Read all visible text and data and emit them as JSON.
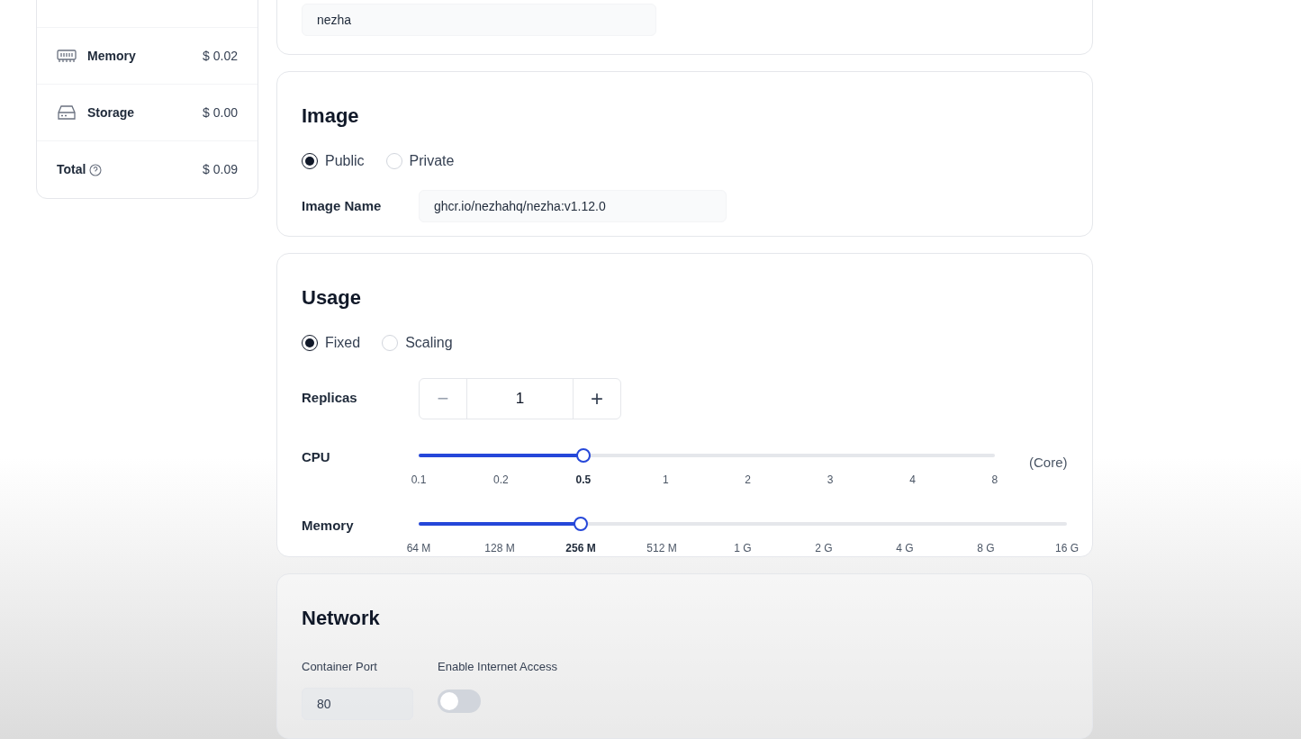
{
  "top_card": {
    "name_value": "nezha"
  },
  "cost": {
    "items": [
      {
        "kind": "memory",
        "label": "Memory",
        "value": "$ 0.02"
      },
      {
        "kind": "storage",
        "label": "Storage",
        "value": "$ 0.00"
      }
    ],
    "total_label": "Total",
    "total_value": "$ 0.09"
  },
  "image": {
    "title": "Image",
    "types": [
      {
        "label": "Public",
        "selected": true
      },
      {
        "label": "Private",
        "selected": false
      }
    ],
    "name_label": "Image Name",
    "name_value": "ghcr.io/nezhahq/nezha:v1.12.0"
  },
  "usage": {
    "title": "Usage",
    "modes": [
      {
        "label": "Fixed",
        "selected": true
      },
      {
        "label": "Scaling",
        "selected": false
      }
    ],
    "replicas": {
      "label": "Replicas",
      "minus": "−",
      "value": "1",
      "plus": "+"
    },
    "sliders": [
      {
        "label": "CPU",
        "level": 0.2857,
        "unit": "(Core)",
        "ticks": [
          {
            "label": "0.1",
            "selected": false
          },
          {
            "label": "0.2",
            "selected": false
          },
          {
            "label": "0.5",
            "selected": true
          },
          {
            "label": "1",
            "selected": false
          },
          {
            "label": "2",
            "selected": false
          },
          {
            "label": "3",
            "selected": false
          },
          {
            "label": "4",
            "selected": false
          },
          {
            "label": "8",
            "selected": false
          }
        ]
      },
      {
        "label": "Memory",
        "level": 0.25,
        "ticks": [
          {
            "label": "64 M",
            "selected": false
          },
          {
            "label": "128 M",
            "selected": false
          },
          {
            "label": "256 M",
            "selected": true
          },
          {
            "label": "512 M",
            "selected": false
          },
          {
            "label": "1 G",
            "selected": false
          },
          {
            "label": "2 G",
            "selected": false
          },
          {
            "label": "4 G",
            "selected": false
          },
          {
            "label": "8 G",
            "selected": false
          },
          {
            "label": "16 G",
            "selected": false
          }
        ]
      }
    ]
  },
  "network": {
    "title": "Network",
    "port_label": "Container Port",
    "port_value": "80",
    "internet_label": "Enable Internet Access",
    "internet_on": false
  }
}
